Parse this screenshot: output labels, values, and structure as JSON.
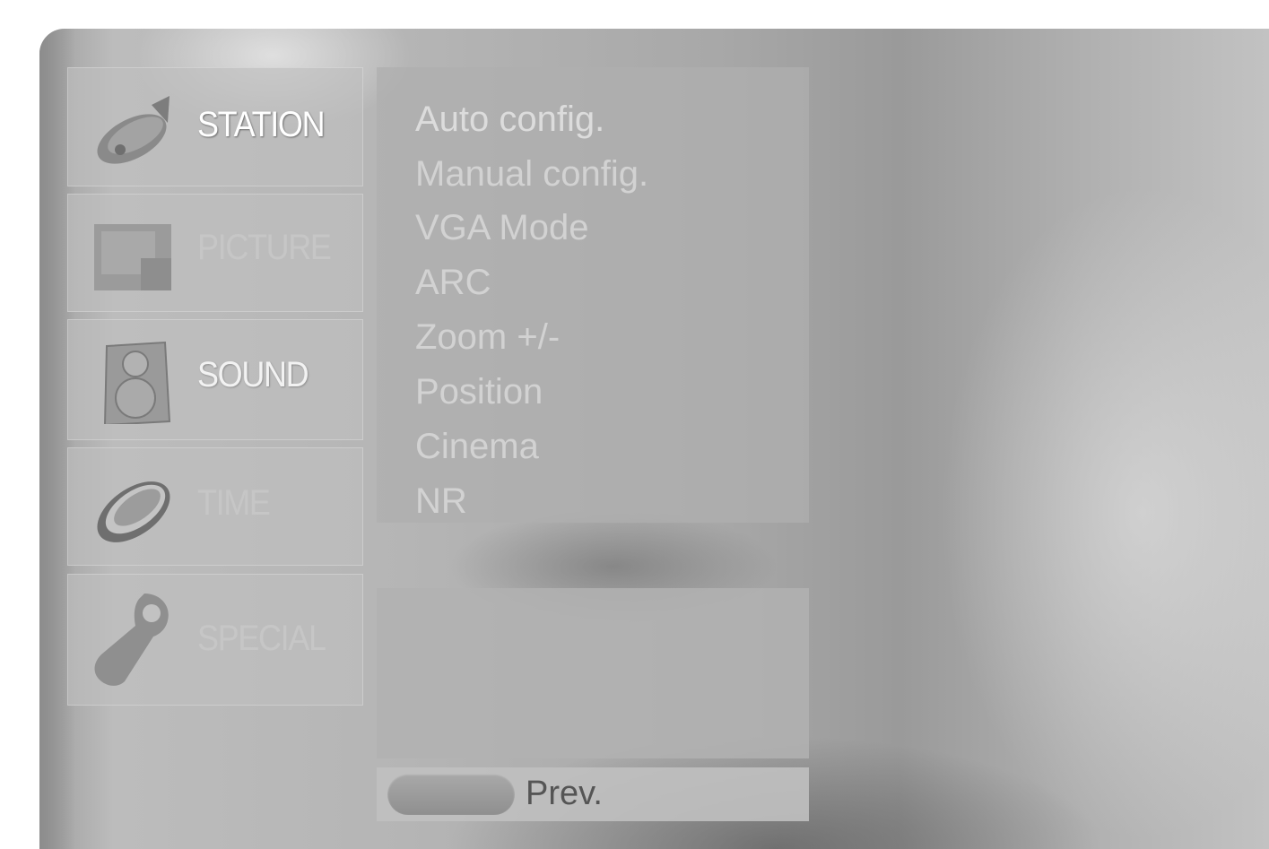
{
  "menu": {
    "items": [
      {
        "label": "STATION",
        "icon": "satellite-dish-icon",
        "state": "active"
      },
      {
        "label": "PICTURE",
        "icon": "picture-icon",
        "state": "dim"
      },
      {
        "label": "SOUND",
        "icon": "speaker-icon",
        "state": "mid"
      },
      {
        "label": "TIME",
        "icon": "clock-icon",
        "state": "dim"
      },
      {
        "label": "SPECIAL",
        "icon": "tag-icon",
        "state": "dim"
      }
    ]
  },
  "submenu": {
    "items": [
      "Auto config.",
      "Manual config.",
      "VGA Mode",
      "ARC",
      "Zoom +/-",
      "Position",
      "Cinema",
      "NR"
    ]
  },
  "footer": {
    "prev_label": "Prev.",
    "button_color": "#9a9a9a"
  }
}
